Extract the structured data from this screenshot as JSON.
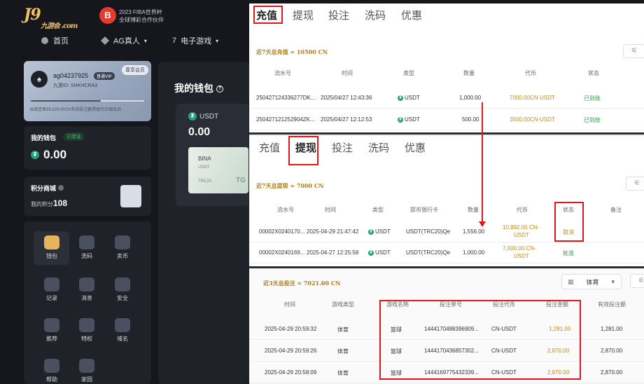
{
  "header": {
    "logo_text": "J9",
    "logo_sub": "九游会 .com",
    "fiba_line1": "2023 FIBA世界杯",
    "fiba_line2": "全球博彩合作伙伴"
  },
  "nav": {
    "items": [
      {
        "label": "首页",
        "icon": "home-icon"
      },
      {
        "label": "AG真人",
        "icon": "diamond-icon"
      },
      {
        "label": "电子游戏",
        "icon": "seven-icon"
      }
    ]
  },
  "user": {
    "name": "ag04237925",
    "vip": "普通VIP",
    "id_text": "九游ID: SHKHCRA3",
    "corner": "尊享会员",
    "progress": 0.62,
    "progress_note": "当周还差89,629.00CN有效投注额晋级为白银会员"
  },
  "wallet": {
    "title": "我的钱包",
    "badge": "已验证",
    "amount": "0.00"
  },
  "points": {
    "title": "积分商城",
    "label": "我的积分",
    "value": "108"
  },
  "grid": [
    {
      "label": "钱包",
      "icon": "wallet-icon"
    },
    {
      "label": "洗码",
      "icon": "rebate-icon"
    },
    {
      "label": "卖币",
      "icon": "sell-coin-icon"
    },
    {
      "label": "记录",
      "icon": "record-icon"
    },
    {
      "label": "消息",
      "icon": "message-icon"
    },
    {
      "label": "安全",
      "icon": "security-icon"
    },
    {
      "label": "推荐",
      "icon": "referral-icon"
    },
    {
      "label": "特权",
      "icon": "crown-icon"
    },
    {
      "label": "域名",
      "icon": "domain-icon"
    },
    {
      "label": "帮助",
      "icon": "help-icon"
    },
    {
      "label": "家园",
      "icon": "home-gear-icon"
    }
  ],
  "middle": {
    "title": "我的钱包",
    "usdt_label": "USDT",
    "usdt_value": "0.00",
    "card_name": "BINA",
    "card_sub": "USDT",
    "card_net": "TRC20",
    "card_brand": "TG"
  },
  "tabs": [
    "充值",
    "提现",
    "投注",
    "洗码",
    "优惠"
  ],
  "deposit": {
    "summary": "近7天总充值 ≈ 10500 CN",
    "columns": [
      "流水号",
      "时间",
      "类型",
      "数量",
      "代币",
      "状态"
    ],
    "rows": [
      {
        "id": "250427124336277DK...",
        "time": "2025/04/27 12:43:36",
        "type": "USDT",
        "qty": "1,000.00",
        "token": "7000.00CN-USDT",
        "status": "已到账"
      },
      {
        "id": "250427121252904ZK...",
        "time": "2025/04/27 12:12:53",
        "type": "USDT",
        "qty": "500.00",
        "token": "3500.00CN-USDT",
        "status": "已到账"
      }
    ]
  },
  "withdraw": {
    "summary": "近7天总提现 ≈ 7000 CN",
    "columns": [
      "流水号",
      "时间",
      "类型",
      "提币银行卡",
      "数量",
      "代币",
      "状态",
      "备注"
    ],
    "rows": [
      {
        "id": "00002X0240170...",
        "time": "2025-04-29 21:47:42",
        "type": "USDT",
        "card": "USDT(TRC20)Qe",
        "qty": "1,556.00",
        "token_a": "10,892.00 CN-",
        "token_b": "USDT",
        "status": "取消"
      },
      {
        "id": "00002X0240169...",
        "time": "2025-04-27 12:25:58",
        "type": "USDT",
        "card": "USDT(TRC20)Qe",
        "qty": "1,000.00",
        "token_a": "7,000.00 CN-",
        "token_b": "USDT",
        "status": "批准"
      }
    ]
  },
  "bets": {
    "summary": "近3天总投注 ≈ 7021.00 CN",
    "select_value": "体育",
    "columns": [
      "时间",
      "游戏类型",
      "游戏名称",
      "投注单号",
      "投注代币",
      "投注金额",
      "有效投注额"
    ],
    "rows": [
      {
        "time": "2025-04-29 20:59:32",
        "type": "体育",
        "name": "篮球",
        "no": "1444170488396909...",
        "token": "CN-USDT",
        "amount": "1,281.00",
        "valid": "1,281.00"
      },
      {
        "time": "2025-04-29 20:59:26",
        "type": "体育",
        "name": "篮球",
        "no": "1444170436857302...",
        "token": "CN-USDT",
        "amount": "2,870.00",
        "valid": "2,870.00"
      },
      {
        "time": "2025-04-29 20:58:09",
        "type": "体育",
        "name": "篮球",
        "no": "1444169775432339...",
        "token": "CN-USDT",
        "amount": "2,870.00",
        "valid": "2,870.00"
      }
    ]
  },
  "colors": {
    "accent_gold": "#e6b45a",
    "highlight_red": "#e0161b",
    "status_green": "#2ea44f",
    "amount_orange": "#d08a12"
  }
}
